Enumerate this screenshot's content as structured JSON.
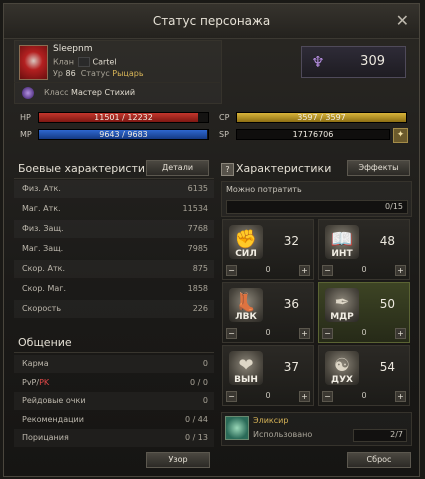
{
  "window": {
    "title": "Статус персонажа",
    "close_glyph": "✕"
  },
  "profile": {
    "name": "Sleepnm",
    "clan_label": "Клан",
    "clan_value": "Cartel",
    "level_label": "Ур",
    "level_value": "86",
    "status_label": "Статус",
    "status_value": "Рыцарь",
    "class_label": "Класс",
    "class_value": "Мастер Стихий"
  },
  "rating": {
    "value": "309"
  },
  "bars": {
    "hp": {
      "label": "HP",
      "text": "11501 / 12232",
      "fraction": 0.94
    },
    "mp": {
      "label": "MP",
      "text": "9643 / 9683",
      "fraction": 0.996
    },
    "cp": {
      "label": "CP",
      "text": "3597 / 3597",
      "fraction": 1.0
    },
    "sp": {
      "label": "SP",
      "text": "17176706"
    }
  },
  "combat": {
    "title": "Боевые характеристики",
    "details_button": "Детали",
    "rows": [
      {
        "label": "Физ. Атк.",
        "value": "6135"
      },
      {
        "label": "Маг. Атк.",
        "value": "11534"
      },
      {
        "label": "Физ. Защ.",
        "value": "7768"
      },
      {
        "label": "Маг. Защ.",
        "value": "7985"
      },
      {
        "label": "Скор. Атк.",
        "value": "875"
      },
      {
        "label": "Скор. Маг.",
        "value": "1858"
      },
      {
        "label": "Скорость",
        "value": "226"
      }
    ]
  },
  "social": {
    "title": "Общение",
    "rows": [
      {
        "label": "Карма",
        "value": "0"
      },
      {
        "label_a": "PvP/",
        "label_b": "PK",
        "value": "0 / 0"
      },
      {
        "label": "Рейдовые очки",
        "value": "0"
      },
      {
        "label": "Рекомендации",
        "value": "0 / 44"
      },
      {
        "label": "Порицания",
        "value": "0 / 13"
      }
    ],
    "view_button": "Узор"
  },
  "characteristics": {
    "title": "Характеристики",
    "effects_button": "Эффекты",
    "spend_label": "Можно потратить",
    "spend_value": "0/15",
    "stats": [
      {
        "abbr": "СИЛ",
        "value": "32",
        "points": "0",
        "icon": "fist-icon",
        "glyph": "✊"
      },
      {
        "abbr": "ИНТ",
        "value": "48",
        "points": "0",
        "icon": "book-icon",
        "glyph": "📖"
      },
      {
        "abbr": "ЛВК",
        "value": "36",
        "points": "0",
        "icon": "boot-icon",
        "glyph": "👢"
      },
      {
        "abbr": "МДР",
        "value": "50",
        "points": "0",
        "icon": "feather-icon",
        "glyph": "✒"
      },
      {
        "abbr": "ВЫН",
        "value": "37",
        "points": "0",
        "icon": "heart-icon",
        "glyph": "❤"
      },
      {
        "abbr": "ДУХ",
        "value": "54",
        "points": "0",
        "icon": "spirit-icon",
        "glyph": "☯"
      }
    ],
    "minus": "−",
    "plus": "+"
  },
  "elixir": {
    "name": "Эликсир",
    "sub": "Использовано",
    "value": "2/7"
  },
  "reset_button": "Сброс",
  "colors": {
    "hp": "#b3261e",
    "mp": "#1f4fb0",
    "cp": "#c9a227",
    "accent_gold": "#d6b357",
    "pk_red": "#e04848"
  }
}
